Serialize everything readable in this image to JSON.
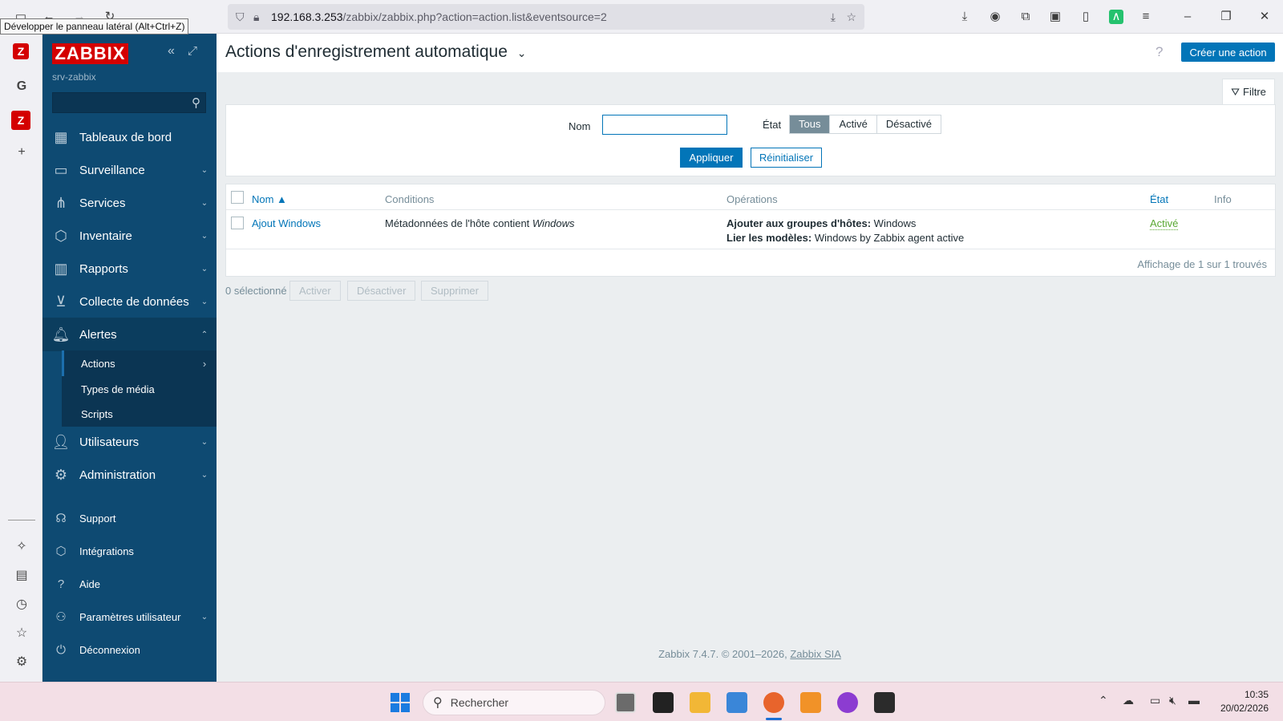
{
  "browser": {
    "tooltip": "Développer le panneau latéral (Alt+Ctrl+Z)",
    "url_host": "192.168.3.253",
    "url_path": "/zabbix/zabbix.php?action=action.list&eventsource=2"
  },
  "sidebar": {
    "logo": "ZABBIX",
    "server": "srv-zabbix",
    "search_placeholder": "",
    "items": [
      {
        "label": "Tableaux de bord",
        "icon": "dashboard-icon"
      },
      {
        "label": "Surveillance",
        "icon": "monitoring-icon"
      },
      {
        "label": "Services",
        "icon": "services-icon"
      },
      {
        "label": "Inventaire",
        "icon": "inventory-icon"
      },
      {
        "label": "Rapports",
        "icon": "reports-icon"
      },
      {
        "label": "Collecte de données",
        "icon": "data-collection-icon"
      },
      {
        "label": "Alertes",
        "icon": "bell-icon"
      },
      {
        "label": "Utilisateurs",
        "icon": "users-icon"
      },
      {
        "label": "Administration",
        "icon": "gear-icon"
      }
    ],
    "alertes_sub": [
      "Actions",
      "Types de média",
      "Scripts"
    ],
    "bottom": [
      {
        "label": "Support",
        "icon": "headset-icon"
      },
      {
        "label": "Intégrations",
        "icon": "integrations-icon"
      },
      {
        "label": "Aide",
        "icon": "help-icon"
      },
      {
        "label": "Paramètres utilisateur",
        "icon": "user-icon"
      },
      {
        "label": "Déconnexion",
        "icon": "power-icon"
      }
    ]
  },
  "header": {
    "title": "Actions d'enregistrement automatique",
    "create_button": "Créer une action"
  },
  "filter": {
    "tab_label": "Filtre",
    "name_label": "Nom",
    "name_value": "",
    "state_label": "État",
    "state_options": [
      "Tous",
      "Activé",
      "Désactivé"
    ],
    "state_selected": "Tous",
    "apply": "Appliquer",
    "reset": "Réinitialiser"
  },
  "table": {
    "columns": [
      "Nom ▲",
      "Conditions",
      "Opérations",
      "État",
      "Info"
    ],
    "rows": [
      {
        "name": "Ajout Windows",
        "condition_prefix": "Métadonnées de l'hôte contient ",
        "condition_value": "Windows",
        "op1_label": "Ajouter aux groupes d'hôtes:",
        "op1_value": " Windows",
        "op2_label": "Lier les modèles:",
        "op2_value": " Windows by Zabbix agent active",
        "state": "Activé"
      }
    ],
    "count_text": "Affichage de 1 sur 1 trouvés"
  },
  "mass": {
    "selected": "0 sélectionné",
    "buttons": [
      "Activer",
      "Désactiver",
      "Supprimer"
    ]
  },
  "footer": {
    "text": "Zabbix 7.4.7. © 2001–2026, ",
    "link": "Zabbix SIA"
  },
  "taskbar": {
    "search": "Rechercher",
    "time": "10:35",
    "date": "20/02/2026"
  },
  "colors": {
    "sidebar": "#0e4a72",
    "accent": "#0275b8",
    "active_state": "#59a833",
    "logo": "#d40000"
  }
}
